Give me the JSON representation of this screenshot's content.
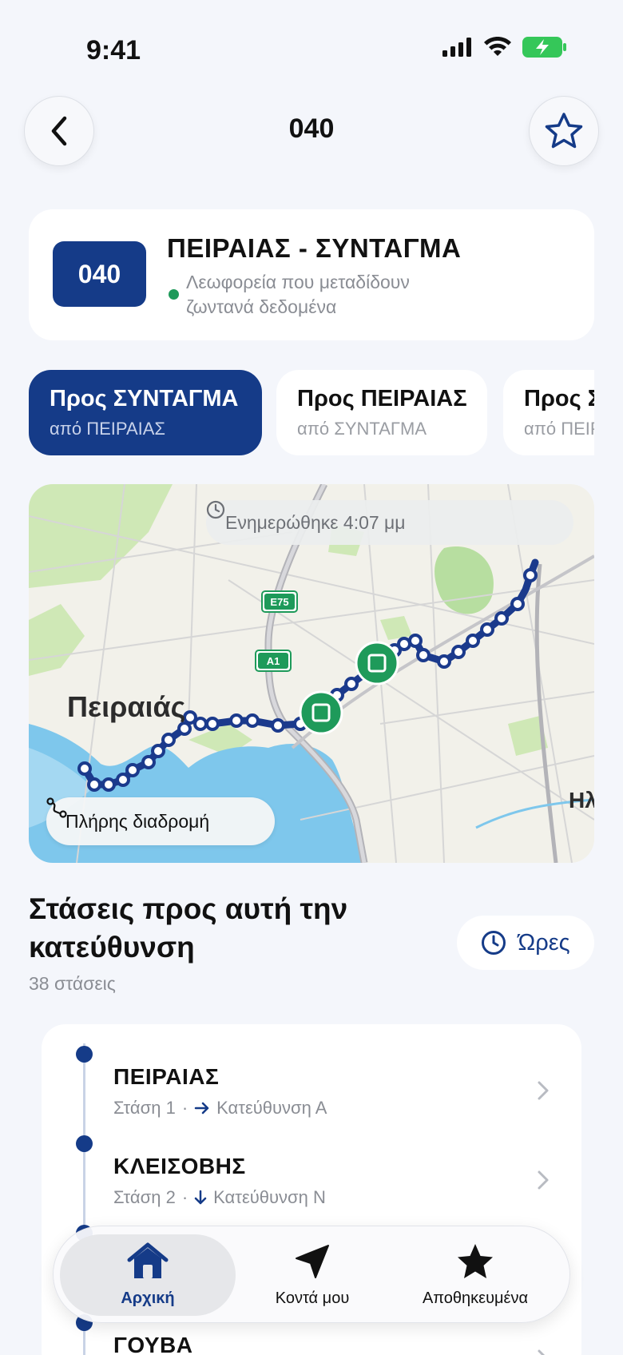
{
  "status": {
    "time": "9:41"
  },
  "header": {
    "title": "040"
  },
  "route": {
    "badge": "040",
    "name": "ΠΕΙΡΑΙΑΣ - ΣΥΝΤΑΓΜΑ",
    "live_text": "Λεωφορεία που μεταδίδουν ζωντανά δεδομένα"
  },
  "directions": [
    {
      "title": "Προς ΣΥΝΤΑΓΜΑ",
      "subtitle": "από ΠΕΙΡΑΙΑΣ",
      "active": true
    },
    {
      "title": "Προς ΠΕΙΡΑΙΑΣ",
      "subtitle": "από ΣΥΝΤΑΓΜΑ",
      "active": false
    },
    {
      "title": "Προς ΣΥΝΤΑΓΜΑ",
      "subtitle": "από ΠΕΙΡΑΙΑΣ",
      "active": false
    }
  ],
  "map": {
    "updated": "Ενημερώθηκε 4:07 μμ",
    "place_label": "Πειραιάς",
    "place_label_2": "Ηλ",
    "road_label_1": "E75",
    "road_label_2": "A1",
    "full_route": "Πλήρης διαδρομή"
  },
  "stops_section": {
    "heading": "Στάσεις προς αυτή την κατεύθυνση",
    "count": "38 στάσεις",
    "hours_label": "Ώρες"
  },
  "stops": [
    {
      "name": "ΠΕΙΡΑΙΑΣ",
      "stop_label": "Στάση 1",
      "direction": "Κατεύθυνση Α",
      "arrow": "right-arrow"
    },
    {
      "name": "ΚΛΕΙΣΟΒΗΣ",
      "stop_label": "Στάση 2",
      "direction": "Κατεύθυνση Ν",
      "arrow": "down-arrow"
    },
    {
      "name": "",
      "stop_label": "",
      "direction": "",
      "arrow": ""
    },
    {
      "name": "ΓΟΥΒΑ",
      "stop_label": "",
      "direction": "",
      "arrow": ""
    }
  ],
  "tabbar": {
    "home": "Αρχική",
    "nearby": "Κοντά μου",
    "saved": "Αποθηκευμένα"
  },
  "colors": {
    "brand": "#153b88",
    "live": "#1e9a5a",
    "route_line": "#1b3a8c"
  }
}
